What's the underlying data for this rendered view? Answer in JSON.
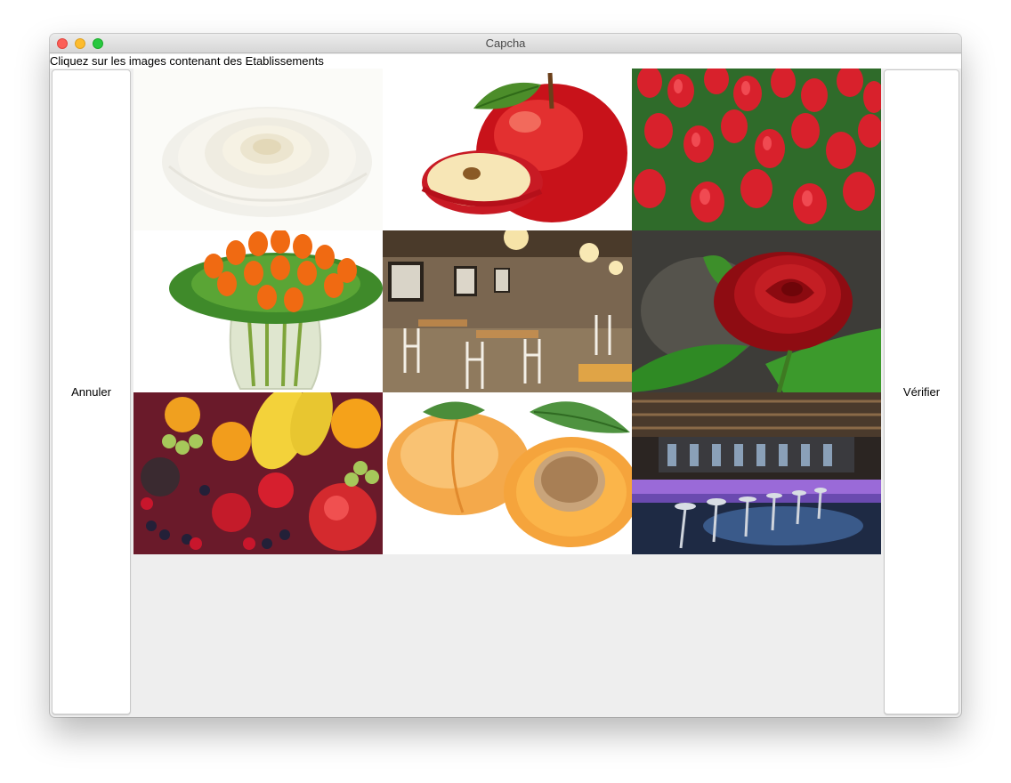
{
  "window": {
    "title": "Capcha"
  },
  "captcha": {
    "instruction": "Cliquez sur les images contenant des Etablissements",
    "cancel_label": "Annuler",
    "verify_label": "Vérifier",
    "tiles": [
      {
        "subject": "white-rose"
      },
      {
        "subject": "red-apple"
      },
      {
        "subject": "red-tulip-field"
      },
      {
        "subject": "tulip-bouquet-vase"
      },
      {
        "subject": "restaurant-interior"
      },
      {
        "subject": "red-rose"
      },
      {
        "subject": "mixed-fruits"
      },
      {
        "subject": "apricots"
      },
      {
        "subject": "bar-interior"
      }
    ]
  },
  "colors": {
    "window_bg": "#eeeeee",
    "close": "#fc5f57",
    "minimize": "#fdbc2e",
    "zoom": "#28c840"
  }
}
